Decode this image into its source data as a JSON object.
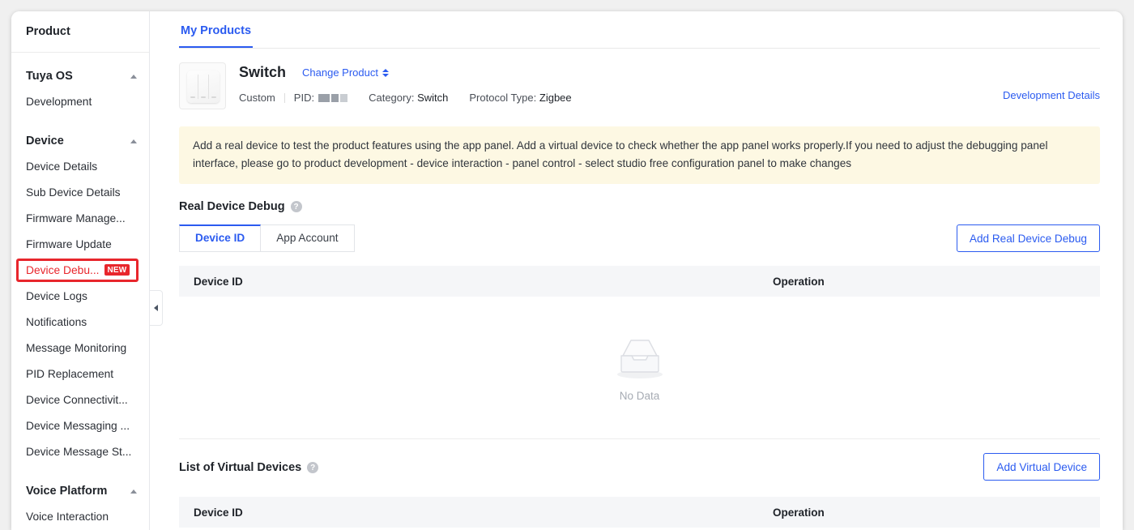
{
  "sidebar": {
    "title": "Product",
    "groups": [
      {
        "label": "Tuya OS",
        "icon": "chevron-up-icon",
        "items": [
          {
            "label": "Development",
            "active": false
          }
        ]
      },
      {
        "label": "Device",
        "icon": "chevron-up-icon",
        "items": [
          {
            "label": "Device Details",
            "active": false
          },
          {
            "label": "Sub Device Details",
            "active": false
          },
          {
            "label": "Firmware Manage...",
            "active": false
          },
          {
            "label": "Firmware Update",
            "active": false
          },
          {
            "label": "Device Debu...",
            "active": true,
            "badge": "NEW"
          },
          {
            "label": "Device Logs",
            "active": false
          },
          {
            "label": "Notifications",
            "active": false
          },
          {
            "label": "Message Monitoring",
            "active": false
          },
          {
            "label": "PID Replacement",
            "active": false
          },
          {
            "label": "Device Connectivit...",
            "active": false
          },
          {
            "label": "Device Messaging ...",
            "active": false
          },
          {
            "label": "Device Message St...",
            "active": false
          }
        ]
      },
      {
        "label": "Voice Platform",
        "icon": "chevron-up-icon",
        "items": [
          {
            "label": "Voice Interaction",
            "active": false
          }
        ]
      }
    ],
    "collapse_handle": "collapse-sidebar"
  },
  "main": {
    "top_tabs": [
      {
        "label": "My Products",
        "active": true
      }
    ],
    "product": {
      "name": "Switch",
      "change_product_label": "Change Product",
      "type_label": "Custom",
      "pid_label": "PID:",
      "pid_value": "",
      "category_label": "Category:",
      "category_value": "Switch",
      "protocol_label": "Protocol Type:",
      "protocol_value": "Zigbee",
      "development_details_label": "Development Details"
    },
    "banner": {
      "text": "Add a real device to test the product features using the app panel. Add a virtual device to check whether the app panel works properly.If you need to adjust the debugging panel interface, please go to product development - device interaction - panel control - select studio free configuration panel to make changes",
      "bg_color": "#fdf8e3"
    },
    "real_device_debug": {
      "title": "Real Device Debug",
      "help_icon": "question-mark-icon",
      "tabs": [
        {
          "label": "Device ID",
          "active": true
        },
        {
          "label": "App Account",
          "active": false
        }
      ],
      "add_button_label": "Add Real Device Debug",
      "table": {
        "columns": [
          "Device ID",
          "Operation"
        ],
        "rows": [],
        "empty_text": "No Data",
        "empty_icon": "empty-inbox-icon"
      }
    },
    "virtual_devices": {
      "title": "List of Virtual Devices",
      "help_icon": "question-mark-icon",
      "add_button_label": "Add Virtual Device",
      "table": {
        "columns": [
          "Device ID",
          "Operation"
        ],
        "rows": []
      }
    }
  },
  "colors": {
    "accent_blue": "#2b5bf0",
    "highlight_red": "#e8262c",
    "banner_bg": "#fdf8e3",
    "table_head_bg": "#f5f6f8"
  }
}
